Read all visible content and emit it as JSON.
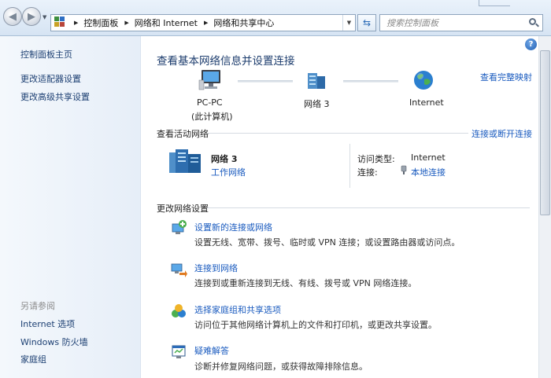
{
  "address_bar": {
    "crumbs": [
      "控制面板",
      "网络和 Internet",
      "网络和共享中心"
    ],
    "search_placeholder": "搜索控制面板"
  },
  "sidebar": {
    "links": [
      "控制面板主页",
      "更改适配器设置",
      "更改高级共享设置"
    ],
    "see_also_caption": "另请参阅",
    "see_also_links": [
      "Internet 选项",
      "Windows 防火墙",
      "家庭组"
    ]
  },
  "main": {
    "title": "查看基本网络信息并设置连接",
    "view_full_map": "查看完整映射",
    "network_map": {
      "computer_name": "PC-PC",
      "computer_note": "(此计算机)",
      "network_name": "网络  3",
      "internet_label": "Internet"
    },
    "active_networks": {
      "heading": "查看活动网络",
      "connect_disconnect": "连接或断开连接",
      "network_name": "网络  3",
      "network_type": "工作网络",
      "access_type_label": "访问类型:",
      "access_type_value": "Internet",
      "connections_label": "连接:",
      "connections_value": "本地连接"
    },
    "change_settings": {
      "heading": "更改网络设置",
      "tasks": [
        {
          "title": "设置新的连接或网络",
          "desc": "设置无线、宽带、拨号、临时或 VPN 连接；或设置路由器或访问点。",
          "icon": "new-connection-icon"
        },
        {
          "title": "连接到网络",
          "desc": "连接到或重新连接到无线、有线、拨号或 VPN 网络连接。",
          "icon": "connect-network-icon"
        },
        {
          "title": "选择家庭组和共享选项",
          "desc": "访问位于其他网络计算机上的文件和打印机，或更改共享设置。",
          "icon": "homegroup-icon"
        },
        {
          "title": "疑难解答",
          "desc": "诊断并修复网络问题，或获得故障排除信息。",
          "icon": "troubleshoot-icon"
        }
      ]
    }
  }
}
